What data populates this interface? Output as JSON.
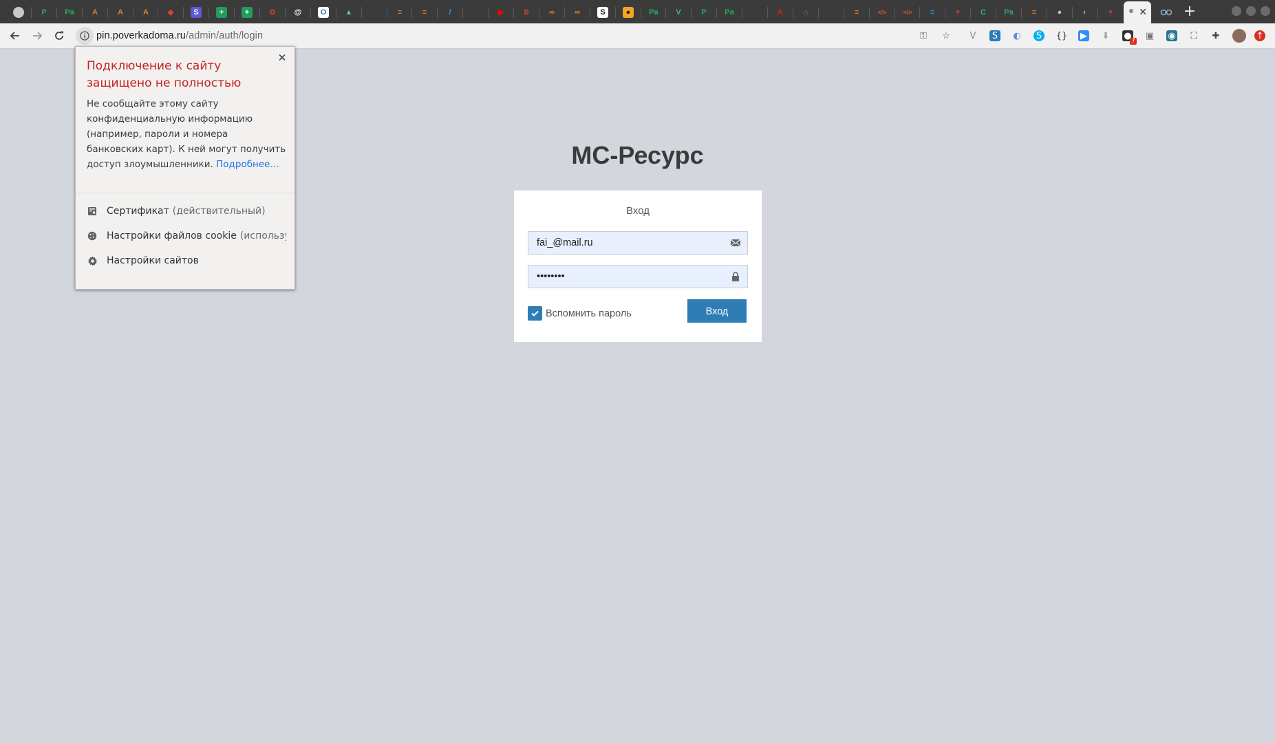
{
  "browser": {
    "tabs": [
      {
        "icon": "circle-icon",
        "glyph": "",
        "color": "#c8c8c8"
      },
      {
        "icon": "p-icon",
        "glyph": "P",
        "color": "#27ae60"
      },
      {
        "icon": "pa-icon",
        "glyph": "Pa",
        "color": "#27ae60"
      },
      {
        "icon": "a-icon",
        "glyph": "A",
        "color": "#e67e22"
      },
      {
        "icon": "a-icon",
        "glyph": "A",
        "color": "#e67e22"
      },
      {
        "icon": "a-icon",
        "glyph": "A",
        "color": "#e67e22"
      },
      {
        "icon": "gitlab-icon",
        "glyph": "◆",
        "color": "#e24329"
      },
      {
        "icon": "s-icon",
        "glyph": "S",
        "color": "#5b5bd6"
      },
      {
        "icon": "plus-green-icon",
        "glyph": "+",
        "color": "#1e9e5a"
      },
      {
        "icon": "plus-green-icon",
        "glyph": "+",
        "color": "#1e9e5a"
      },
      {
        "icon": "paw-icon",
        "glyph": "✿",
        "color": "#c0392b"
      },
      {
        "icon": "at-icon",
        "glyph": "@",
        "color": "#ffffff"
      },
      {
        "icon": "o-icon",
        "glyph": "O",
        "color": "#2c6fbf"
      },
      {
        "icon": "android-icon",
        "glyph": "▲",
        "color": "#3ddc84"
      },
      {
        "icon": "blank-icon",
        "glyph": "",
        "color": "#3b3b3b"
      },
      {
        "icon": "stack-icon",
        "glyph": "≡",
        "color": "#f48024"
      },
      {
        "icon": "stack-icon",
        "glyph": "≡",
        "color": "#f48024"
      },
      {
        "icon": "pen-icon",
        "glyph": "/",
        "color": "#3498db"
      },
      {
        "icon": "blank-icon",
        "glyph": "",
        "color": "#3b3b3b"
      },
      {
        "icon": "youtube-icon",
        "glyph": "▶",
        "color": "#ff0000"
      },
      {
        "icon": "s-red-icon",
        "glyph": "S",
        "color": "#e74c3c"
      },
      {
        "icon": "swirl-icon",
        "glyph": "∞",
        "color": "#e67e22"
      },
      {
        "icon": "swirl-icon",
        "glyph": "∞",
        "color": "#e67e22"
      },
      {
        "icon": "s-dark-icon",
        "glyph": "S",
        "color": "#111111"
      },
      {
        "icon": "dot-icon",
        "glyph": "●",
        "color": "#f5a623"
      },
      {
        "icon": "pa-icon",
        "glyph": "Pa",
        "color": "#27ae60"
      },
      {
        "icon": "vue-icon",
        "glyph": "V",
        "color": "#41b883"
      },
      {
        "icon": "p-icon",
        "glyph": "P",
        "color": "#27ae60"
      },
      {
        "icon": "pa-icon",
        "glyph": "Pa",
        "color": "#27ae60"
      },
      {
        "icon": "blank-icon",
        "glyph": "",
        "color": "#3b3b3b"
      },
      {
        "icon": "angular-icon",
        "glyph": "A",
        "color": "#dd1b16"
      },
      {
        "icon": "home-icon",
        "glyph": "⌂",
        "color": "#3498db"
      },
      {
        "icon": "blank-icon",
        "glyph": "",
        "color": "#3b3b3b"
      },
      {
        "icon": "stack-icon",
        "glyph": "≡",
        "color": "#f48024"
      },
      {
        "icon": "code-icon",
        "glyph": "</>",
        "color": "#e74c3c"
      },
      {
        "icon": "code-icon",
        "glyph": "</>",
        "color": "#e74c3c"
      },
      {
        "icon": "stack-blue-icon",
        "glyph": "≡",
        "color": "#3498db"
      },
      {
        "icon": "heart-icon",
        "glyph": "♥",
        "color": "#b03a2e"
      },
      {
        "icon": "c-icon",
        "glyph": "C",
        "color": "#1abc9c"
      },
      {
        "icon": "pa-icon",
        "glyph": "Pa",
        "color": "#27ae60"
      },
      {
        "icon": "stack-icon",
        "glyph": "≡",
        "color": "#f48024"
      },
      {
        "icon": "github-icon",
        "glyph": "●",
        "color": "#bbbbbb"
      },
      {
        "icon": "globe-icon",
        "glyph": "◐",
        "color": "#999999"
      },
      {
        "icon": "heart-icon",
        "glyph": "♥",
        "color": "#b03a2e"
      }
    ],
    "active_tab_close": "✕",
    "extra_tab_icon": "glasses-icon",
    "new_tab": "+",
    "url_host": "pin.poverkadoma.ru",
    "url_path": "/admin/auth/login",
    "toolbar_icons": [
      "key-icon",
      "star-icon",
      "v-icon",
      "s-icon",
      "fish-icon",
      "skype-icon",
      "json-icon",
      "zoom-icon",
      "download-icon",
      "notification-icon",
      "image-icon",
      "color-picker-icon",
      "screenshot-icon",
      "puzzle-icon",
      "avatar",
      "update-icon"
    ],
    "notification_count": "7"
  },
  "popup": {
    "title": "Подключение к сайту защищено не полностью",
    "body": "Не сообщайте этому сайту конфиденциальную информацию (например, пароли и номера банковских карт). К ней могут получить доступ злоумышленники.",
    "more_link": "Подробнее…",
    "close": "✕",
    "items": [
      {
        "icon": "certificate-icon",
        "label": "Сертификат",
        "note": "(действительный)"
      },
      {
        "icon": "cookie-icon",
        "label": "Настройки файлов cookie",
        "note": "(используется)"
      },
      {
        "icon": "settings-gear-icon",
        "label": "Настройки сайтов",
        "note": ""
      }
    ]
  },
  "login": {
    "app_title": "МС-Ресурс",
    "card_title": "Вход",
    "email_value": "fai_@mail.ru",
    "password_value": "12345678",
    "remember_label": "Вспомнить пароль",
    "remember_checked": true,
    "submit_label": "Вход"
  },
  "colors": {
    "page_bg": "#d3d6dd",
    "primary": "#2f7db5",
    "warning_title": "#c5221f",
    "link": "#1a73e8",
    "input_bg": "#e8f0fe"
  }
}
